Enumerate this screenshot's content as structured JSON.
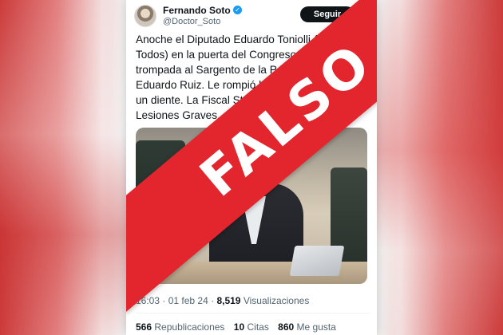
{
  "tweet": {
    "author_name": "Fernando Soto",
    "author_handle": "@Doctor_Soto",
    "follow_label": "Seguir",
    "more_icon": "more-vertical-icon",
    "verified_icon": "verified-badge-icon",
    "text": "Anoche el Diputado Eduardo Toniolli (Frente de Todos) en la puerta del Congreso le pegó una trompada al Sargento de la Policía Federal Eduardo Ruiz. Le rompió los  anteojos y le voló un diente. La Fiscal Stanciano lo imputó por Lesiones Graves, art. 90 del Código Penal",
    "time": "16:03",
    "date": "01 feb 24",
    "views_count": "8,519",
    "views_label": "Visualizaciones",
    "reposts_count": "566",
    "reposts_label": "Republicaciones",
    "quotes_count": "10",
    "quotes_label": "Citas",
    "likes_count": "860",
    "likes_label": "Me gusta"
  },
  "overlay": {
    "label": "FALSO",
    "color": "#e3262d"
  },
  "colors": {
    "verified": "#1d9bf0",
    "follow_bg": "#0f1419"
  }
}
